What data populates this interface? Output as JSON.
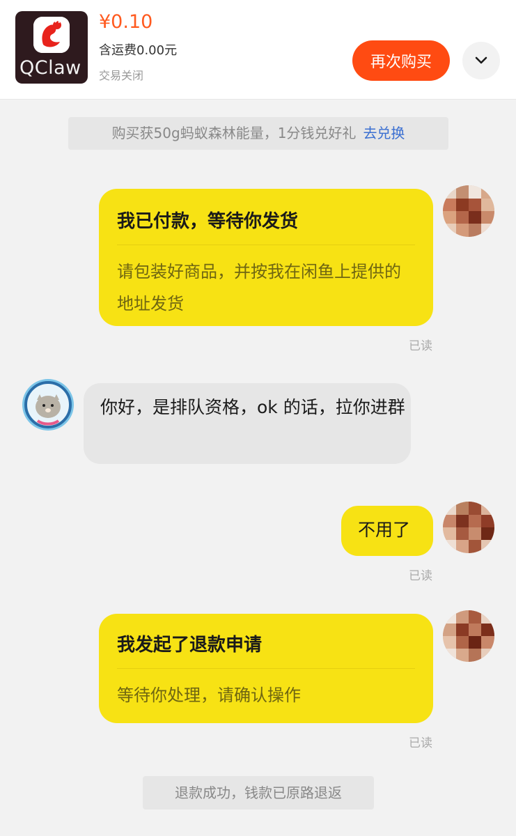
{
  "header": {
    "thumbnail_brand": "QClaw",
    "price": "¥0.10",
    "shipping": "含运费0.00元",
    "status": "交易关闭",
    "rebuy_label": "再次购买",
    "more_icon": "chevron-down-icon"
  },
  "notice": {
    "text": "购买获50g蚂蚁森林能量，1分钱兑好礼",
    "link": "去兑换"
  },
  "messages": [
    {
      "title": "我已付款，等待你发货",
      "body": "请包装好商品，并按我在闲鱼上提供的地址发货",
      "read": "已读"
    },
    {
      "text": "你好，是排队资格，ok 的话，拉你进群"
    },
    {
      "text": "不用了",
      "read": "已读"
    },
    {
      "title": "我发起了退款申请",
      "body": "等待你处理，请确认操作",
      "read": "已读"
    }
  ],
  "refund_notice": "退款成功，钱款已原路退返",
  "colors": {
    "accent": "#ff4b12",
    "price": "#ff5a1f",
    "bubble_yellow": "#f7e214",
    "link": "#3a6fd1"
  }
}
